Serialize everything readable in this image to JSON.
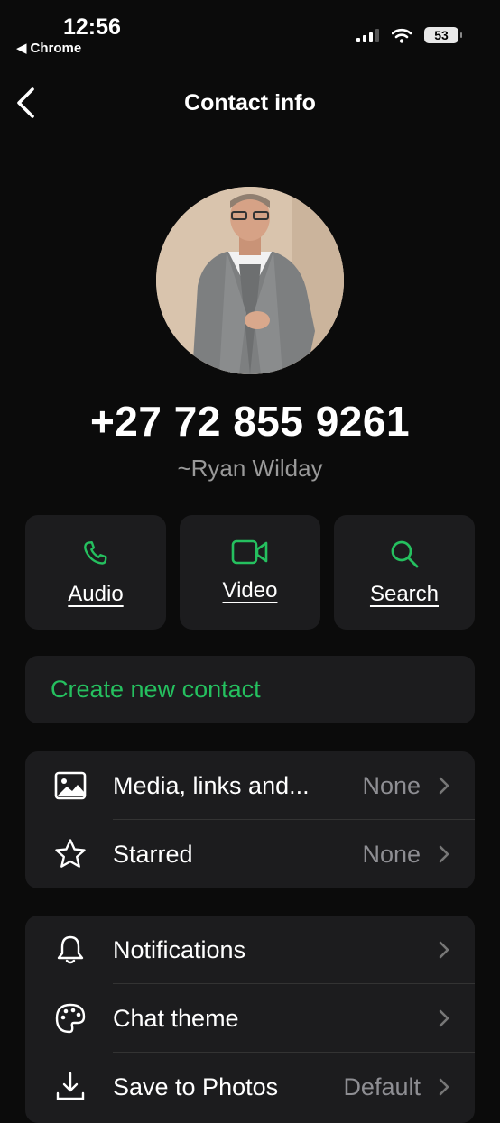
{
  "status": {
    "time": "12:56",
    "back_app": "Chrome",
    "battery": "53"
  },
  "nav": {
    "title": "Contact info"
  },
  "contact": {
    "phone": "+27 72 855 9261",
    "alias": "~Ryan Wilday"
  },
  "actions": [
    {
      "label": "Audio",
      "icon": "phone-icon"
    },
    {
      "label": "Video",
      "icon": "video-icon"
    },
    {
      "label": "Search",
      "icon": "search-icon"
    }
  ],
  "create_contact": "Create new contact",
  "media_group": [
    {
      "label": "Media, links and...",
      "value": "None",
      "icon": "image-icon"
    },
    {
      "label": "Starred",
      "value": "None",
      "icon": "star-icon"
    }
  ],
  "settings_group": [
    {
      "label": "Notifications",
      "icon": "bell-icon"
    },
    {
      "label": "Chat theme",
      "icon": "palette-icon"
    },
    {
      "label": "Save to Photos",
      "value": "Default",
      "icon": "download-icon"
    }
  ],
  "colors": {
    "accent": "#25c05f",
    "background": "#0b0b0b",
    "card": "#1c1c1e",
    "muted": "#8e8e93"
  }
}
